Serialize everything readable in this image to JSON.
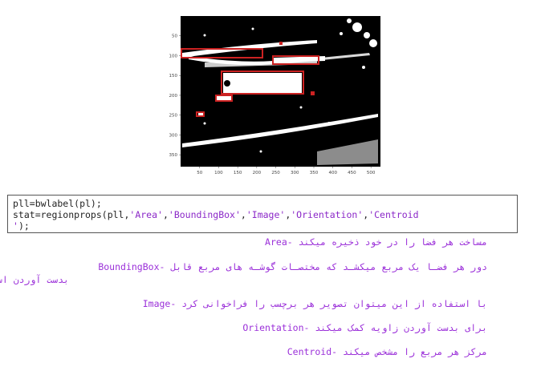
{
  "figure": {
    "x_ticks": [
      "50",
      "100",
      "150",
      "200",
      "250",
      "300",
      "350",
      "400",
      "450",
      "500"
    ],
    "y_ticks": [
      "50",
      "100",
      "150",
      "200",
      "250",
      "300",
      "350"
    ],
    "box_color": "#cc2222"
  },
  "code": {
    "line1": "pll=bwlabel(pl);",
    "line2_prefix": "stat=regionprops(pll,",
    "arg1": "'Area'",
    "sep1": ",",
    "arg2": "'BoundingBox'",
    "sep2": ",",
    "arg3": "'Image'",
    "sep3": ",",
    "arg4": "'Orientation'",
    "sep4": ",",
    "arg5_part1": "'Centroid",
    "arg5_part2": "'",
    "line3_suffix": ");"
  },
  "descriptions": [
    {
      "text": "Area- مساخت هر فضا را در خود ذخیره میکند"
    },
    {
      "text": "BoundingBox- دور هر فضـا یک مربع میکشـد که مختصـات گوشـه های مربع قابل"
    },
    {
      "text": "بدست آوردن است"
    },
    {
      "text": "Image- با استفاده از این میتوان تصویر هر برچسب را فراخوانی کرد"
    },
    {
      "text": "Orientation- برای بدست آوردن زاویه کمک میکند"
    },
    {
      "text": "Centroid- مرکز هر مربع را مشخص میکند"
    }
  ]
}
